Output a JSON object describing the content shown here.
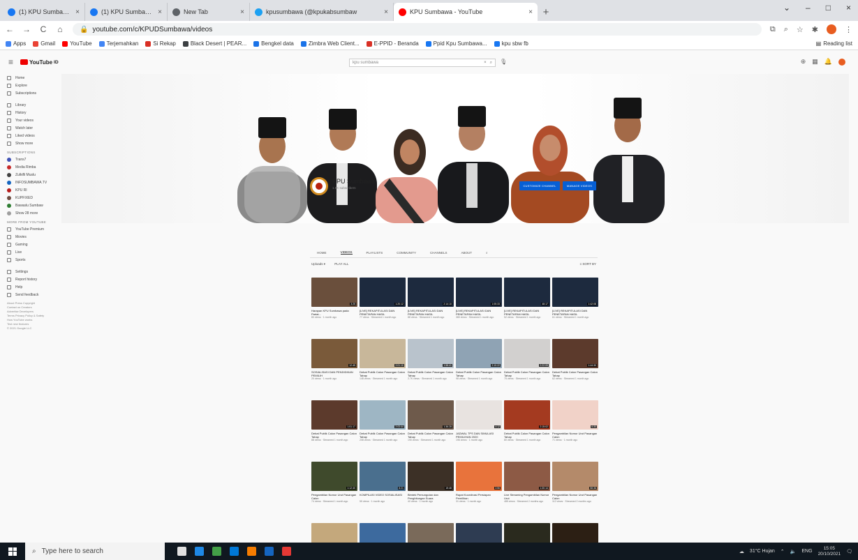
{
  "browser": {
    "tabs": [
      {
        "title": "(1) KPU Sumbawa | Facebook",
        "favicon": "facebook-icon",
        "color": "#1877f2",
        "active": false
      },
      {
        "title": "(1) KPU Sumbawa | Facebook",
        "favicon": "facebook-icon",
        "color": "#1877f2",
        "active": false
      },
      {
        "title": "New Tab",
        "favicon": "globe-icon",
        "color": "#5f6368",
        "active": false
      },
      {
        "title": "kpusumbawa (@kpukabsumbaw",
        "favicon": "twitter-icon",
        "color": "#1da1f2",
        "active": false
      },
      {
        "title": "KPU Sumbawa - YouTube",
        "favicon": "youtube-icon",
        "color": "#ff0000",
        "active": true
      }
    ],
    "tab_close": "×",
    "new_tab": "+",
    "window_controls": {
      "minimize": "–",
      "maximize": "□",
      "close": "×",
      "chevron": "⌄"
    },
    "address_url": "youtube.com/c/KPUDSumbawa/videos",
    "nav": {
      "back": "←",
      "forward": "→",
      "reload": "C",
      "home": "⌂"
    },
    "bookmarks": [
      {
        "label": "Apps",
        "color": "#4285f4"
      },
      {
        "label": "Gmail",
        "color": "#ea4335"
      },
      {
        "label": "YouTube",
        "color": "#ff0000"
      },
      {
        "label": "Terjemahkan",
        "color": "#4285f4"
      },
      {
        "label": "Si Rekap",
        "color": "#d93025"
      },
      {
        "label": "Black Desert | PEAR...",
        "color": "#3c4043"
      },
      {
        "label": "Bengkel data",
        "color": "#1a73e8"
      },
      {
        "label": "Zimbra Web Client...",
        "color": "#1a73e8"
      },
      {
        "label": "E-PPID - Beranda",
        "color": "#d93025"
      },
      {
        "label": "Ppid Kpu Sumbawa...",
        "color": "#1877f2"
      },
      {
        "label": "kpu sbw fb",
        "color": "#1877f2"
      }
    ],
    "reading_list": "Reading list"
  },
  "youtube": {
    "logo": "YouTube",
    "logo_suffix": "ID",
    "search_placeholder": "kpu sumbawa",
    "search_icons": {
      "clear": "×",
      "search": "⌕",
      "mic": "🎙"
    },
    "header_icons": {
      "create": "⊕",
      "apps": "▦",
      "bell": "🔔"
    },
    "sidebar": {
      "main": [
        "Home",
        "Explore",
        "Subscriptions"
      ],
      "library": [
        "Library",
        "History",
        "Your videos",
        "Watch later",
        "Liked videos",
        "Show more"
      ],
      "subscriptions_title": "SUBSCRIPTIONS",
      "subscriptions": [
        "Trans7",
        "Media Rimba",
        "Zulkifli Muslu",
        "INFOSUMBAWA.TV",
        "KPU RI",
        "KUPFIXED",
        "Bawaslu Sumbaw",
        "Show 28 more"
      ],
      "more_title": "MORE FROM YOUTUBE",
      "more": [
        "YouTube Premium",
        "Movies",
        "Gaming",
        "Live",
        "Sports"
      ],
      "settings": [
        "Settings",
        "Report history",
        "Help",
        "Send feedback"
      ],
      "footer": [
        "About Press Copyright",
        "Contact us Creators",
        "Advertise Developers",
        "Terms Privacy Policy & Safety",
        "How YouTube works",
        "Test new features",
        "© 2021 Google LLC"
      ]
    },
    "channel": {
      "name": "KPU Sumbawa",
      "subscribers": "1.9K subscribers",
      "customize_button": "CUSTOMIZE CHANNEL",
      "manage_button": "MANAGE VIDEOS",
      "tabs": [
        "HOME",
        "VIDEOS",
        "PLAYLISTS",
        "COMMUNITY",
        "CHANNELS",
        "ABOUT"
      ],
      "search_tab_icon": "⌕",
      "filter_uploads": "Uploads ▾",
      "filter_play_all": "PLAY ALL",
      "sort_by": "SORT BY"
    },
    "video_rows": [
      [
        {
          "title": "Harapan KPU Sumbawa pada Partai...",
          "meta": "80 views · 1 month ago",
          "bg": "#6a4f3c",
          "dur": "3:25"
        },
        {
          "title": "[LIVE] REKAPITULASI DAN PENETAPAN HASIL",
          "meta": "77 views · Streamed 1 month ago",
          "bg": "#1d2a3e",
          "dur": "1:20:12"
        },
        {
          "title": "[LIVE] REKAPITULASI DAN PENETAPAN HASIL",
          "meta": "88 views · Streamed 1 month ago",
          "bg": "#1d2a3e",
          "dur": "2:14:10"
        },
        {
          "title": "[LIVE] REKAPITULASI DAN PENETAPAN HASIL",
          "meta": "380 views · Streamed 1 month ago",
          "bg": "#1d2a3e",
          "dur": "1:05:33"
        },
        {
          "title": "[LIVE] REKAPITULASI DAN PENETAPAN HASIL",
          "meta": "52 views · Streamed 1 month ago",
          "bg": "#1d2a3e",
          "dur": "48:17"
        },
        {
          "title": "[LIVE] REKAPITULASI DAN PENETAPAN HASIL",
          "meta": "61 views · Streamed 1 month ago",
          "bg": "#1d2a3e",
          "dur": "1:42:08"
        }
      ],
      [
        {
          "title": "SOSIALISASI DAN PENDIDIKAN PEMILIH",
          "meta": "20 views · 1 month ago",
          "bg": "#7a5a3a",
          "dur": "12:45"
        },
        {
          "title": "Debat Publik Calon Pasangan Calon Tahap",
          "meta": "148 views · Streamed 1 month ago",
          "bg": "#c8b79a",
          "dur": "2:01:10"
        },
        {
          "title": "Debat Publik Calon Pasangan Calon Tahap",
          "meta": "2.7K views · Streamed 1 month ago",
          "bg": "#b9c3cc",
          "dur": "1:58:41"
        },
        {
          "title": "Debat Publik Calon Pasangan Calon Tahap",
          "meta": "98 views · Streamed 1 month ago",
          "bg": "#8fa3b4",
          "dur": "2:10:22"
        },
        {
          "title": "Debat Publik Calon Pasangan Calon Tahap",
          "meta": "75 views · Streamed 1 month ago",
          "bg": "#d2d0cf",
          "dur": "2:22:05"
        },
        {
          "title": "Debat Publik Calon Pasangan Calon Tahap",
          "meta": "62 views · Streamed 1 month ago",
          "bg": "#5c3a2c",
          "dur": "1:44:30"
        }
      ],
      [
        {
          "title": "Debat Publik Calon Pasangan Calon Tahap",
          "meta": "88 views · Streamed 1 month ago",
          "bg": "#5c3a2c",
          "dur": "1:51:17"
        },
        {
          "title": "Debat Publik Calon Pasangan Calon Tahap",
          "meta": "208 views · Streamed 1 month ago",
          "bg": "#9eb6c4",
          "dur": "2:03:44"
        },
        {
          "title": "Debat Publik Calon Pasangan Calon Tahap",
          "meta": "190 views · Streamed 1 month ago",
          "bg": "#6e5a4b",
          "dur": "1:36:28"
        },
        {
          "title": "JADWAL TPS DAN SIMULASI PEMILIHAN 2020",
          "meta": "196 views · 1 month ago",
          "bg": "#e8e3e0",
          "dur": "4:12"
        },
        {
          "title": "Debat Publik Calon Pasangan Calon Tahap",
          "meta": "80 views · Streamed 1 month ago",
          "bg": "#a43a20",
          "dur": "2:15:02"
        },
        {
          "title": "Pengambilan Nomor Urut Pasangan Calon",
          "meta": "71 views · 1 month ago",
          "bg": "#f1d2c8",
          "dur": "6:30"
        }
      ],
      [
        {
          "title": "Pengambilan Nomor Urut Pasangan Calon",
          "meta": "74 views · Streamed 1 month ago",
          "bg": "#3f4a2c",
          "dur": "1:12:40"
        },
        {
          "title": "KOMPILASI VIDEO SOSIALISASI",
          "meta": "55 views · 1 month ago",
          "bg": "#4a6f8e",
          "dur": "8:21"
        },
        {
          "title": "Bimtek Pemungutan dan Penghitungan Suara",
          "meta": "40 views · 1 month ago",
          "bg": "#3c3026",
          "dur": "15:48"
        },
        {
          "title": "Rapat Koordinasi Persiapan Pemilihan",
          "meta": "31 views · 1 month ago",
          "bg": "#e8733c",
          "dur": "3:56"
        },
        {
          "title": "Live Streaming Pengambilan Nomor Urut",
          "meta": "485 views · Streamed 2 months ago",
          "bg": "#8d5a45",
          "dur": "1:30:14"
        },
        {
          "title": "Pengambilan Nomor Urut Pasangan Calon",
          "meta": "112 views · Streamed 2 months ago",
          "bg": "#b48a6a",
          "dur": "58:36"
        }
      ],
      [
        {
          "title": "",
          "meta": "",
          "bg": "#c4a87c",
          "dur": ""
        },
        {
          "title": "",
          "meta": "",
          "bg": "#3d6a9e",
          "dur": ""
        },
        {
          "title": "",
          "meta": "",
          "bg": "#7a6a5a",
          "dur": ""
        },
        {
          "title": "",
          "meta": "",
          "bg": "#2e3c52",
          "dur": ""
        },
        {
          "title": "",
          "meta": "",
          "bg": "#2a2a1e",
          "dur": ""
        },
        {
          "title": "",
          "meta": "",
          "bg": "#2c1f14",
          "dur": ""
        }
      ]
    ]
  },
  "taskbar": {
    "search_placeholder": "Type here to search",
    "apps": [
      "#e0e0e0",
      "#1e88e5",
      "#43a047",
      "#0078d7",
      "#f57c00",
      "#1565c0",
      "#e53935"
    ],
    "weather": "31°C Hujan",
    "language": "ENG",
    "time": "15:05",
    "date": "20/10/2021"
  }
}
